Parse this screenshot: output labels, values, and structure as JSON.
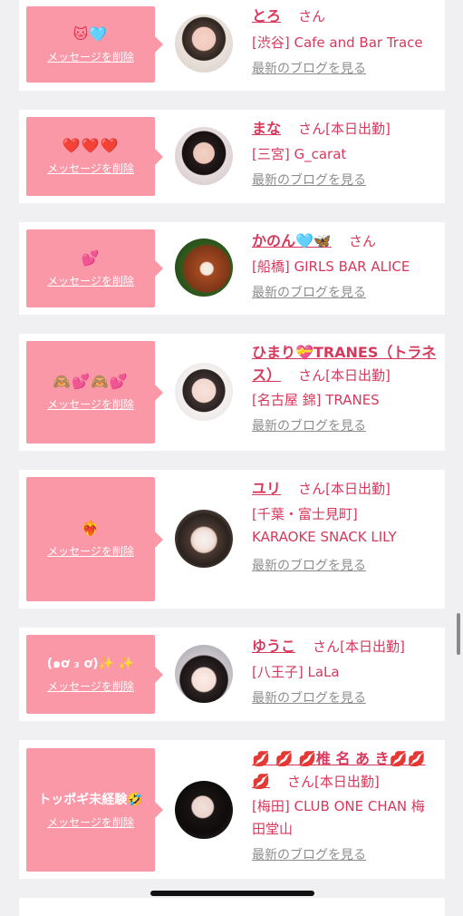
{
  "common": {
    "delete_label": "メッセージを削除",
    "blog_label": "最新のブログを見る"
  },
  "entries": [
    {
      "message": "🐱🩵",
      "name": "とろ",
      "honorific": "さん",
      "status": "",
      "shop": "[渋谷] Cafe and Bar Trace"
    },
    {
      "message": "❤️❤️❤️",
      "name": "まな",
      "honorific": "さん",
      "status": "[本日出勤]",
      "shop": "[三宮] G_carat"
    },
    {
      "message": "💕",
      "name": "かのん🩵🦋",
      "honorific": "さん",
      "status": "",
      "shop": "[船橋] GIRLS BAR ALICE"
    },
    {
      "message": "🙈💕🙈💕",
      "name": "ひまり💝TRANES（トラネス）",
      "honorific": "さん",
      "status": "[本日出勤]",
      "shop": "[名古屋 錦] TRANES"
    },
    {
      "message": "❤️‍🔥",
      "name": "ユリ",
      "honorific": "さん",
      "status": "[本日出勤]",
      "shop": "[千葉・富士見町] KARAOKE SNACK LILY"
    },
    {
      "message": "(๑ơ ₃ ơ)✨ ✨",
      "name": "ゆうこ",
      "honorific": "さん",
      "status": "[本日出勤]",
      "shop": "[八王子] LaLa"
    },
    {
      "message": "トッポギ未経験🤣",
      "name": "💋 💋 💋椎 名 あ き💋💋 💋",
      "honorific": "さん",
      "status": "[本日出勤]",
      "shop": "[梅田] CLUB ONE CHAN 梅田堂山"
    }
  ]
}
